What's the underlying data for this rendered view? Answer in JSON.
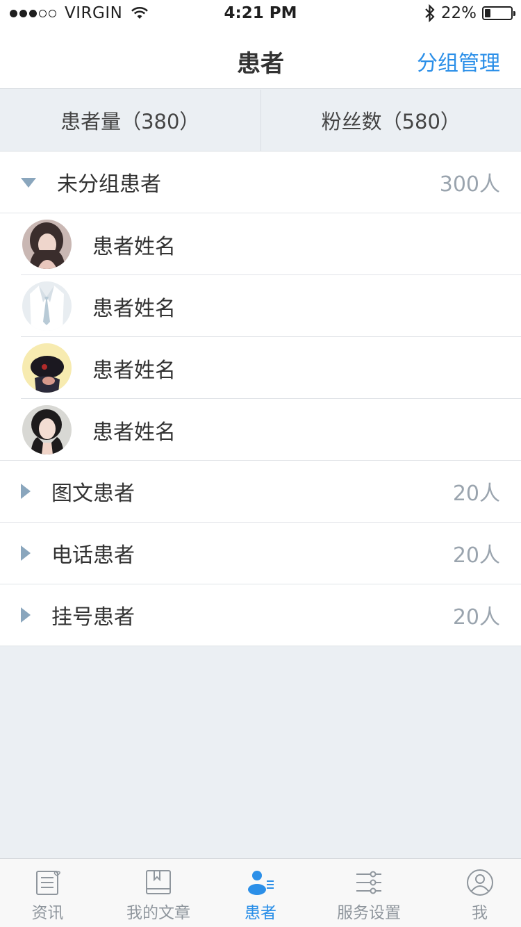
{
  "status_bar": {
    "carrier": "VIRGIN",
    "time": "4:21 PM",
    "battery": "22%",
    "battery_level": 0.22
  },
  "nav": {
    "title": "患者",
    "action_label": "分组管理"
  },
  "stats": {
    "patients_label": "患者量（380）",
    "fans_label": "粉丝数（580）"
  },
  "groups": [
    {
      "name": "未分组患者",
      "count": "300人",
      "expanded": true,
      "patients": [
        {
          "name": "患者姓名",
          "avatar": "woman-long-hair-avatar"
        },
        {
          "name": "患者姓名",
          "avatar": "suit-avatar"
        },
        {
          "name": "患者姓名",
          "avatar": "cap-avatar"
        },
        {
          "name": "患者姓名",
          "avatar": "woman-portrait-avatar"
        }
      ]
    },
    {
      "name": "图文患者",
      "count": "20人",
      "expanded": false
    },
    {
      "name": "电话患者",
      "count": "20人",
      "expanded": false
    },
    {
      "name": "挂号患者",
      "count": "20人",
      "expanded": false
    }
  ],
  "colors": {
    "accent": "#2b8fe8",
    "arrow": "#8aa6bd",
    "background": "#ebeff3"
  },
  "tabs": [
    {
      "label": "资讯",
      "icon": "news-icon",
      "active": false
    },
    {
      "label": "我的文章",
      "icon": "article-book-icon",
      "active": false
    },
    {
      "label": "患者",
      "icon": "patients-icon",
      "active": true
    },
    {
      "label": "服务设置",
      "icon": "settings-sliders-icon",
      "active": false
    },
    {
      "label": "我",
      "icon": "profile-icon",
      "active": false
    }
  ]
}
